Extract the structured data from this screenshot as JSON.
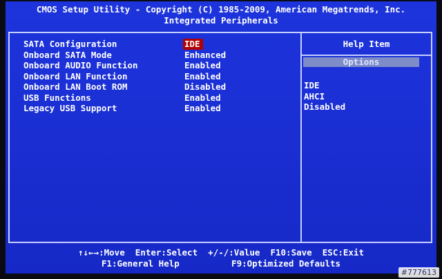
{
  "header": {
    "line1": "CMOS Setup Utility - Copyright (C) 1985-2009, American Megatrends, Inc.",
    "line2": "Integrated Peripherals"
  },
  "settings": [
    {
      "label": "SATA Configuration",
      "value": "IDE",
      "selected": true
    },
    {
      "label": "Onboard SATA Mode",
      "value": "Enhanced",
      "selected": false
    },
    {
      "label": "Onboard AUDIO Function",
      "value": "Enabled",
      "selected": false
    },
    {
      "label": "Onboard LAN Function",
      "value": "Enabled",
      "selected": false
    },
    {
      "label": "Onboard LAN Boot ROM",
      "value": "Disabled",
      "selected": false
    },
    {
      "label": "USB Functions",
      "value": "Enabled",
      "selected": false
    },
    {
      "label": "Legacy USB Support",
      "value": "Enabled",
      "selected": false
    }
  ],
  "help": {
    "title": "Help Item",
    "options_label": "Options",
    "options": [
      "IDE",
      "AHCI",
      "Disabled"
    ]
  },
  "footer": {
    "move": "↑↓←→:Move",
    "select": "Enter:Select",
    "value": "+/-/:Value",
    "save": "F10:Save",
    "exit": "ESC:Exit",
    "help": "F1:General Help",
    "defaults": "F9:Optimized Defaults"
  },
  "watermark": "#777613",
  "colors": {
    "background": "#1a2fd6",
    "selected_highlight": "#b30000",
    "options_bar": "#7e8cc8",
    "text": "#ffffff"
  }
}
